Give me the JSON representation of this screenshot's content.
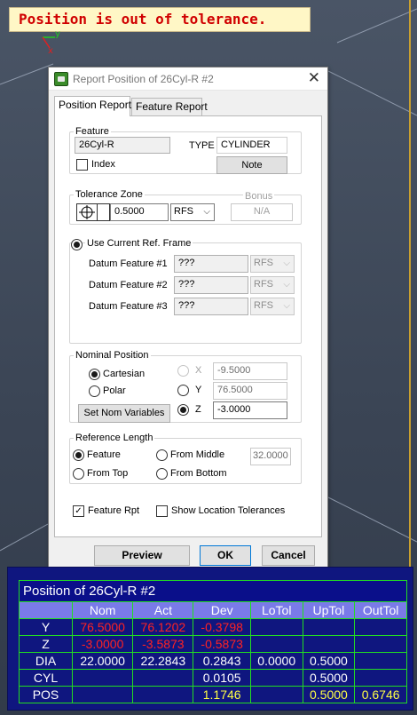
{
  "banner": {
    "text": "Position is out of tolerance."
  },
  "axes": {
    "y": "y",
    "x": "x"
  },
  "dialog": {
    "title": "Report Position of 26Cyl-R #2",
    "close": "✕",
    "tabs": [
      {
        "label": "Position Report",
        "active": true
      },
      {
        "label": "Feature Report",
        "active": false
      }
    ],
    "feature": {
      "group_label": "Feature",
      "name": "26Cyl-R",
      "type_label": "TYPE",
      "type_value": "CYLINDER",
      "index_label": "Index",
      "index_checked": false,
      "note_button": "Note"
    },
    "tolerance_zone": {
      "group_label": "Tolerance Zone",
      "value": "0.5000",
      "modifier": "RFS",
      "bonus_label": "Bonus",
      "bonus_value": "N/A"
    },
    "ref_frame": {
      "radio_label": "Use Current Ref. Frame",
      "selected": true,
      "datums": [
        {
          "label": "Datum Feature #1",
          "value": "???",
          "modifier": "RFS"
        },
        {
          "label": "Datum Feature #2",
          "value": "???",
          "modifier": "RFS"
        },
        {
          "label": "Datum Feature #3",
          "value": "???",
          "modifier": "RFS"
        }
      ]
    },
    "nominal": {
      "group_label": "Nominal Position",
      "cartesian_label": "Cartesian",
      "polar_label": "Polar",
      "set_nom_button": "Set Nom Variables",
      "x_label": "X",
      "x_value": "-9.5000",
      "y_label": "Y",
      "y_value": "76.5000",
      "z_label": "Z",
      "z_value": "-3.0000"
    },
    "ref_length": {
      "group_label": "Reference Length",
      "feature_label": "Feature",
      "from_top_label": "From Top",
      "from_middle_label": "From Middle",
      "from_bottom_label": "From Bottom",
      "value": "32.0000"
    },
    "feature_rpt_label": "Feature Rpt",
    "feature_rpt_checked": true,
    "show_loc_tol_label": "Show Location Tolerances",
    "show_loc_tol_checked": false,
    "buttons": {
      "preview": "Preview",
      "ok": "OK",
      "cancel": "Cancel"
    }
  },
  "report": {
    "title": "Position of 26Cyl-R #2",
    "headers": [
      "",
      "Nom",
      "Act",
      "Dev",
      "LoTol",
      "UpTol",
      "OutTol"
    ],
    "rows": [
      {
        "cells": [
          "Y",
          "76.5000",
          "76.1202",
          "-0.3798",
          "",
          "",
          ""
        ]
      },
      {
        "cells": [
          "Z",
          "-3.0000",
          "-3.5873",
          "-0.5873",
          "",
          "",
          ""
        ]
      },
      {
        "cells": [
          "DIA",
          "22.0000",
          "22.2843",
          "0.2843",
          "0.0000",
          "0.5000",
          ""
        ]
      },
      {
        "cells": [
          "CYL",
          "",
          "",
          "0.0105",
          "",
          "0.5000",
          ""
        ]
      },
      {
        "cells": [
          "POS",
          "",
          "",
          "1.1746",
          "",
          "0.5000",
          "0.6746"
        ]
      }
    ],
    "colors": {
      "background": "#0f167f",
      "grid": "#22dd22",
      "header": "#7a7ae8",
      "out": "#ff2222",
      "pos": "#ffff44"
    }
  }
}
